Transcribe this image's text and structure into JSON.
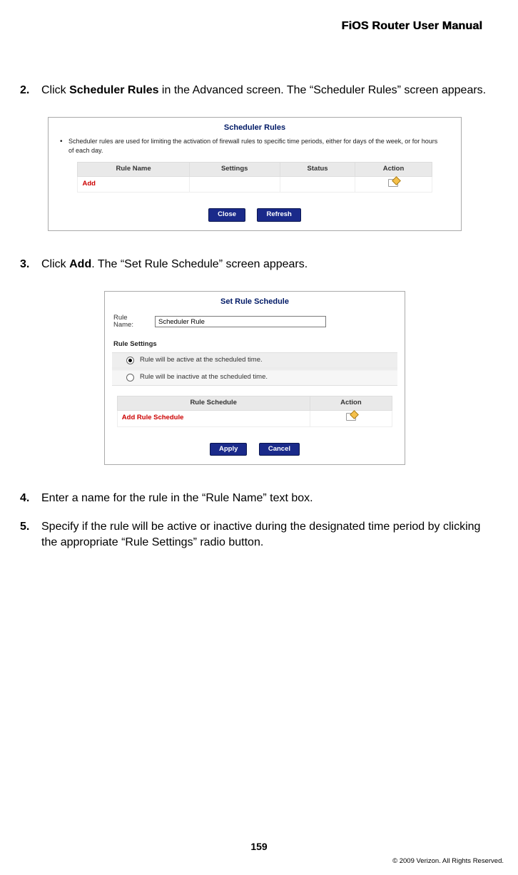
{
  "doc_title": "FiOS Router User Manual",
  "steps": {
    "s2": {
      "num": "2.",
      "pre": "Click ",
      "bold": "Scheduler Rules",
      "post": " in the Advanced screen. The “Scheduler Rules” screen appears."
    },
    "s3": {
      "num": "3.",
      "pre": "Click ",
      "bold": "Add",
      "post": ". The “Set Rule Schedule” screen appears."
    },
    "s4": {
      "num": "4.",
      "text": "Enter a name for the rule in the “Rule Name” text box."
    },
    "s5": {
      "num": "5.",
      "text": "Specify if the rule will be active or inactive during the designated time period by clicking the appropriate “Rule Settings” radio button."
    }
  },
  "scr1": {
    "title": "Scheduler Rules",
    "intro": "Scheduler rules are used for limiting the activation of firewall rules to specific time periods, either for days of the week, or for hours of each day.",
    "cols": {
      "c1": "Rule Name",
      "c2": "Settings",
      "c3": "Status",
      "c4": "Action"
    },
    "add": "Add",
    "btn_close": "Close",
    "btn_refresh": "Refresh"
  },
  "scr2": {
    "title": "Set Rule Schedule",
    "rule_name_label": "Rule Name:",
    "rule_name_value": "Scheduler Rule",
    "rule_settings_head": "Rule Settings",
    "opt_active": "Rule will be active at the scheduled time.",
    "opt_inactive": "Rule will be inactive at the scheduled time.",
    "cols": {
      "c1": "Rule Schedule",
      "c2": "Action"
    },
    "add": "Add Rule Schedule",
    "btn_apply": "Apply",
    "btn_cancel": "Cancel"
  },
  "page_number": "159",
  "copyright": "© 2009 Verizon. All Rights Reserved."
}
